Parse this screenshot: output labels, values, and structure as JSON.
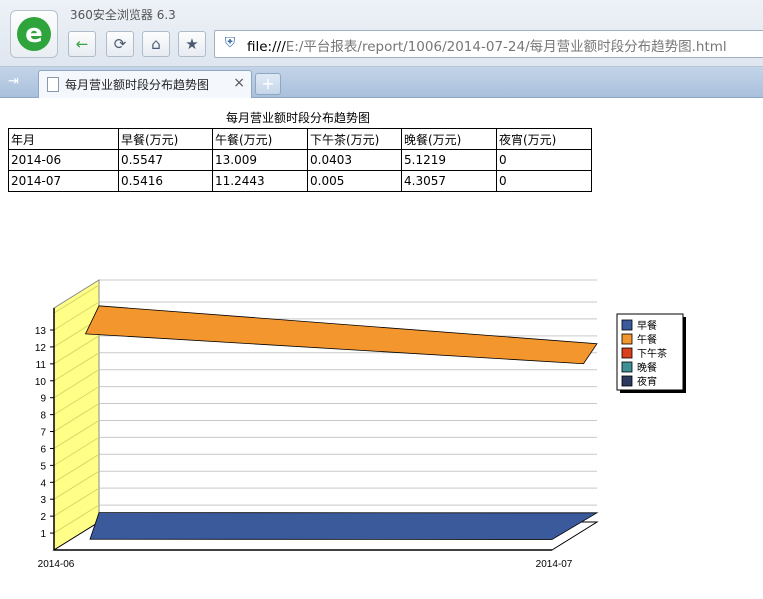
{
  "browser": {
    "app_title": "360安全浏览器 6.3",
    "logo_glyph": "e",
    "nav": {
      "back_glyph": "←",
      "refresh_glyph": "⟳",
      "home_glyph": "⌂",
      "favorite_glyph": "★"
    },
    "address": {
      "scheme": "file:///",
      "path": "E:/平台报表/report/1006/2014-07-24/每月营业额时段分布趋势图.html"
    },
    "tab": {
      "label": "每月营业额时段分布趋势图",
      "close_glyph": "×"
    },
    "new_tab_glyph": "+"
  },
  "report": {
    "title": "每月营业额时段分布趋势图",
    "columns": [
      "年月",
      "早餐(万元)",
      "午餐(万元)",
      "下午茶(万元)",
      "晚餐(万元)",
      "夜宵(万元)"
    ],
    "rows": [
      [
        "2014-06",
        "0.5547",
        "13.009",
        "0.0403",
        "5.1219",
        "0"
      ],
      [
        "2014-07",
        "0.5416",
        "11.2443",
        "0.005",
        "4.3057",
        "0"
      ]
    ]
  },
  "chart_data": {
    "type": "area",
    "title": "",
    "xlabel": "",
    "ylabel": "",
    "categories": [
      "2014-06",
      "2014-07"
    ],
    "ylim": [
      0,
      13
    ],
    "yticks": [
      1,
      2,
      3,
      4,
      5,
      6,
      7,
      8,
      9,
      10,
      11,
      12,
      13
    ],
    "grid": true,
    "three_d": true,
    "legend_position": "right",
    "series": [
      {
        "name": "早餐",
        "values": [
          0.5547,
          0.5416
        ],
        "color": "#3a5a9c"
      },
      {
        "name": "午餐",
        "values": [
          13.009,
          11.2443
        ],
        "color": "#f4962e"
      },
      {
        "name": "下午茶",
        "values": [
          0.0403,
          0.005
        ],
        "color": "#d9401c"
      },
      {
        "name": "晚餐",
        "values": [
          5.1219,
          4.3057
        ],
        "color": "#3f8f96"
      },
      {
        "name": "夜宵",
        "values": [
          0,
          0
        ],
        "color": "#2b3a5e"
      }
    ],
    "wall_color": "#ffff88"
  }
}
